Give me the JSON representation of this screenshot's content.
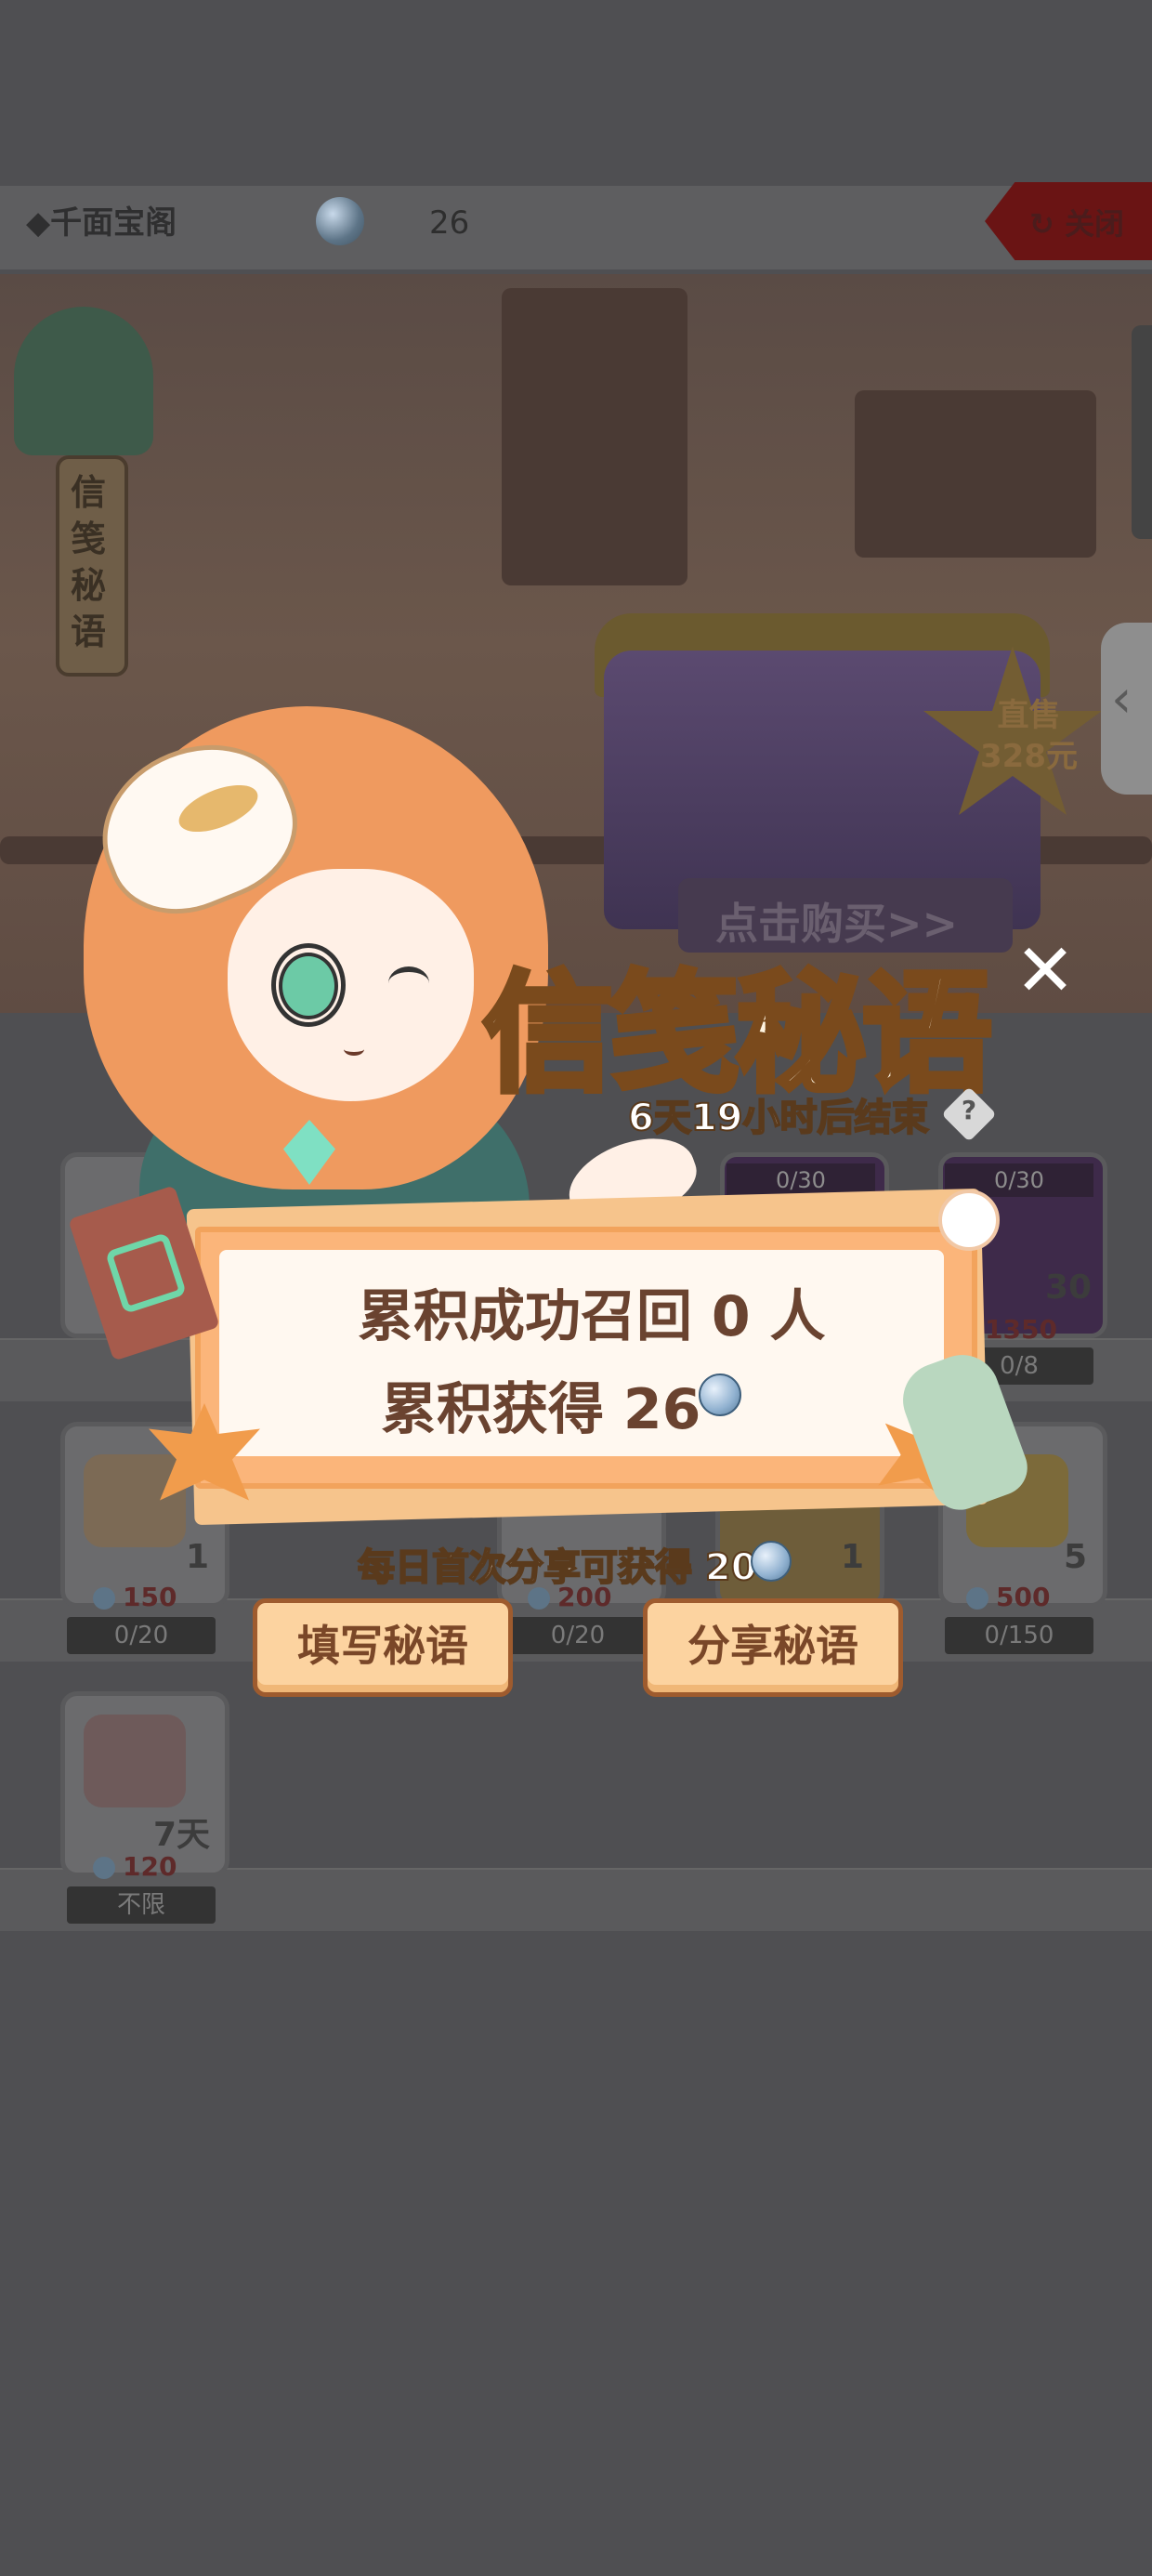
{
  "shop": {
    "title": "◆千面宝阁",
    "currency_icon": "gem-icon",
    "currency_count": "26",
    "close_label": "关闭",
    "banner": {
      "scroll_text": "信笺秘语",
      "price_line1": "直售",
      "price_line2": "328元",
      "buy_label": "点击购买>>"
    },
    "items_row1": [
      {
        "qty": "",
        "price": "",
        "limit": ""
      },
      {
        "qty": "",
        "price": "",
        "limit": ""
      },
      {
        "qty": "",
        "price": "",
        "limit": ""
      },
      {
        "qty": "",
        "price": "",
        "limit": "",
        "top": "0/30"
      },
      {
        "qty": "30",
        "price": "1350",
        "limit": "0/8",
        "top": "0/30"
      }
    ],
    "items_row2": [
      {
        "qty": "1",
        "price": "150",
        "limit": "0/20"
      },
      {
        "qty": "",
        "price": "",
        "limit": ""
      },
      {
        "qty": "",
        "price": "200",
        "limit": "0/20"
      },
      {
        "qty": "1",
        "price": "",
        "limit": ""
      },
      {
        "qty": "5",
        "price": "500",
        "limit": "0/150"
      }
    ],
    "items_row3": [
      {
        "qty": "7天",
        "price": "120",
        "limit": "不限"
      }
    ]
  },
  "popup": {
    "title": "信笺秘语",
    "countdown": "6天19小时后结束",
    "help_symbol": "?",
    "stat_recalled": "累积成功召回 0 人",
    "stat_earned": "累积获得 26",
    "share_hint": "每日首次分享可获得 20",
    "fill_button": "填写秘语",
    "share_button": "分享秘语",
    "close_symbol": "✕"
  },
  "colors": {
    "overlay": "#4f4f52",
    "title_fill": "#fff4e0",
    "board": "#fbb57a",
    "button_fill": "#fcd3a0",
    "button_border": "#9e5b2e"
  }
}
